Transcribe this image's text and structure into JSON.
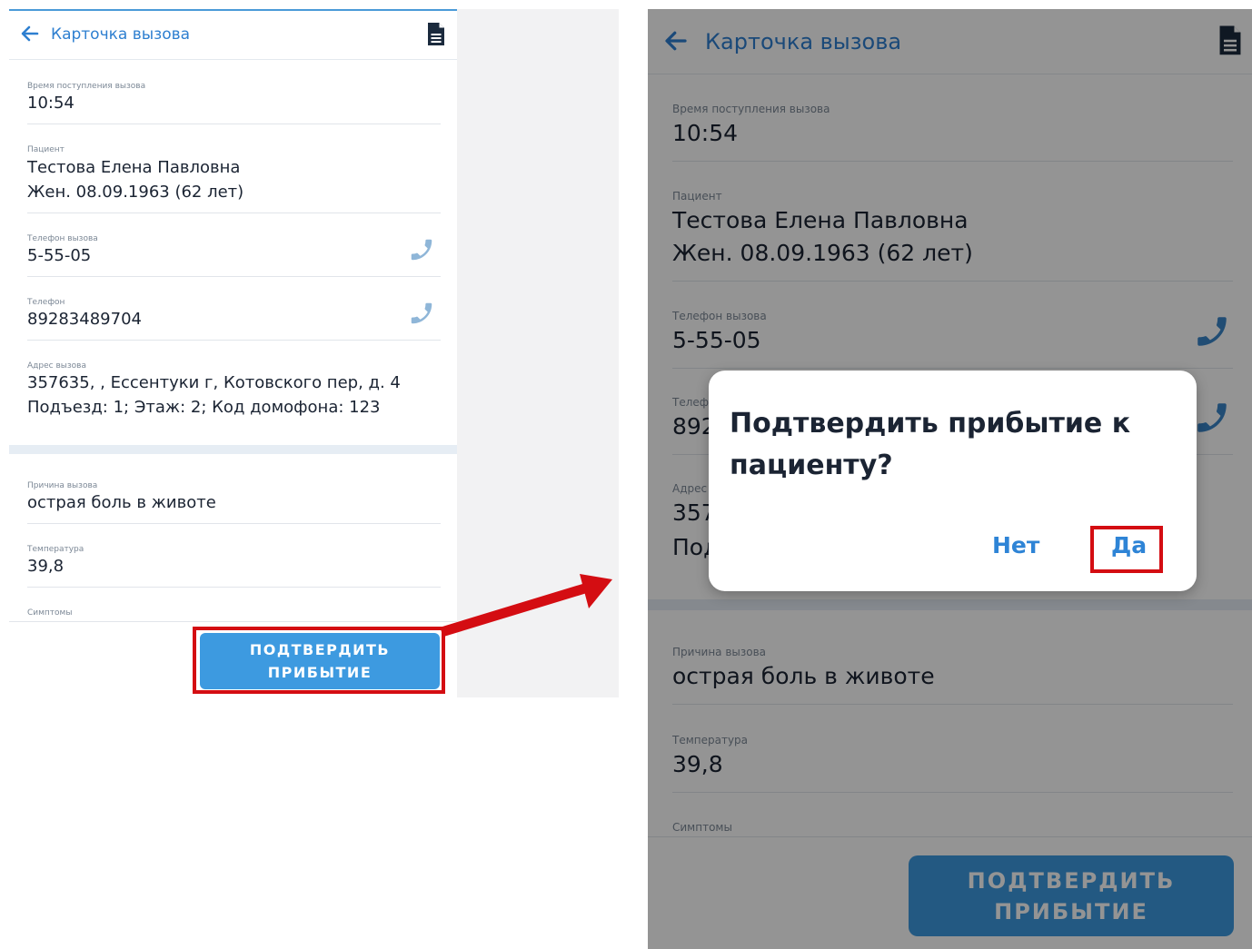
{
  "header": {
    "title": "Карточка вызова",
    "back_icon": "arrow-left-icon",
    "document_icon": "document-icon"
  },
  "fields": {
    "call_time": {
      "label": "Время поступления вызова",
      "value": "10:54"
    },
    "patient": {
      "label": "Пациент",
      "name": "Тестова Елена Павловна",
      "details": "Жен. 08.09.1963 (62 лет)"
    },
    "call_phone": {
      "label": "Телефон вызова",
      "value": "5-55-05",
      "icon": "phone-icon"
    },
    "phone": {
      "label": "Телефон",
      "value": "89283489704",
      "icon": "phone-icon"
    },
    "address": {
      "label": "Адрес вызова",
      "line1": "357635, , Ессентуки г, Котовского пер, д. 4",
      "line2": "Подъезд: 1; Этаж: 2; Код домофона: 123"
    },
    "reason": {
      "label": "Причина вызова",
      "value": "острая боль в животе"
    },
    "temperature": {
      "label": "Температура",
      "value": "39,8"
    },
    "symptoms": {
      "label": "Симптомы"
    }
  },
  "confirm_button": {
    "line1": "ПОДТВЕРДИТЬ",
    "line2": "ПРИБЫТИЕ"
  },
  "dialog": {
    "title": "Подтвердить прибытие к пациенту?",
    "no_label": "Нет",
    "yes_label": "Да"
  },
  "colors": {
    "accent": "#2e7fd0",
    "button": "#3d9ae0",
    "highlight": "#d40d12",
    "text": "#1b2433",
    "label": "#7c8896"
  }
}
